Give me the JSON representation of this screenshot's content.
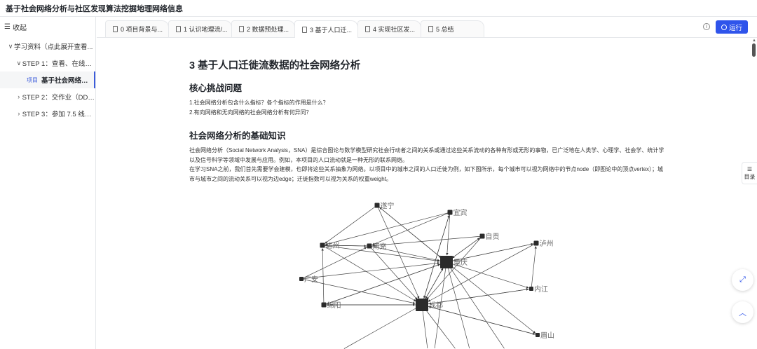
{
  "app": {
    "title": "基于社会网络分析与社区发现算法挖掘地理网络信息"
  },
  "sidebar": {
    "collapse_label": "收起",
    "tree": [
      {
        "label": "学习资料（点此展开查看..."
      },
      {
        "label": "STEP 1：查看、在线运..."
      },
      {
        "tag": "项目",
        "label": "基于社会网络分析..."
      },
      {
        "label": "STEP 2：交作业（DDL ..."
      },
      {
        "label": "STEP 3：参加 7.5 线上..."
      }
    ]
  },
  "tabs": [
    {
      "label": "0 项目背景与..."
    },
    {
      "label": "1 认识地理流/..."
    },
    {
      "label": "2 数据预处理..."
    },
    {
      "label": "3 基于人口迁..."
    },
    {
      "label": "4 实现社区发..."
    },
    {
      "label": "5 总结"
    }
  ],
  "toolbar": {
    "run_label": "运行"
  },
  "doc": {
    "title": "3 基于人口迁徙流数据的社会网络分析",
    "h_core": "核心挑战问题",
    "q1": "1.社会网络分析包含什么指标？各个指标的作用是什么？",
    "q2": "2.有向网络和无向网络的社会网络分析有何异同？",
    "h_basic": "社会网络分析的基础知识",
    "p1": "社会网络分析（Social Network Analysis，SNA）是综合图论与数学模型研究社会行动者之间的关系或通过这些关系流动的各种有形或无形的事物，已广泛地在人类学、心理学、社会学、统计学以及信号科学等领域中发展与应用。例如，本项目的人口流动就是一种无形的联系网络。",
    "p2": "在学习SNA之前，我们首先需要学会建模，也即将这些关系抽象为网络。以项目中的城市之间的人口迁徙为例，如下图所示，每个城市可以视为网络中的节点node（即图论中的顶点vertex）；城市与城市之间的流动关系可以视为边edge；迁徙指数可以视为关系的权重weight。"
  },
  "network": {
    "nodes": [
      {
        "id": "suining",
        "label": "遂宁"
      },
      {
        "id": "yibin",
        "label": "宜宾"
      },
      {
        "id": "zigong",
        "label": "自贡"
      },
      {
        "id": "luzhou",
        "label": "泸州"
      },
      {
        "id": "dazhou",
        "label": "达州"
      },
      {
        "id": "nanchong",
        "label": "南充"
      },
      {
        "id": "chongqing",
        "label": "重庆"
      },
      {
        "id": "guangan",
        "label": "广安"
      },
      {
        "id": "neijiang",
        "label": "内江"
      },
      {
        "id": "mianyang",
        "label": "绵阳"
      },
      {
        "id": "chengdu",
        "label": "成都"
      },
      {
        "id": "meishan",
        "label": "眉山"
      }
    ]
  },
  "right_panel": {
    "toc_label": "目录"
  }
}
